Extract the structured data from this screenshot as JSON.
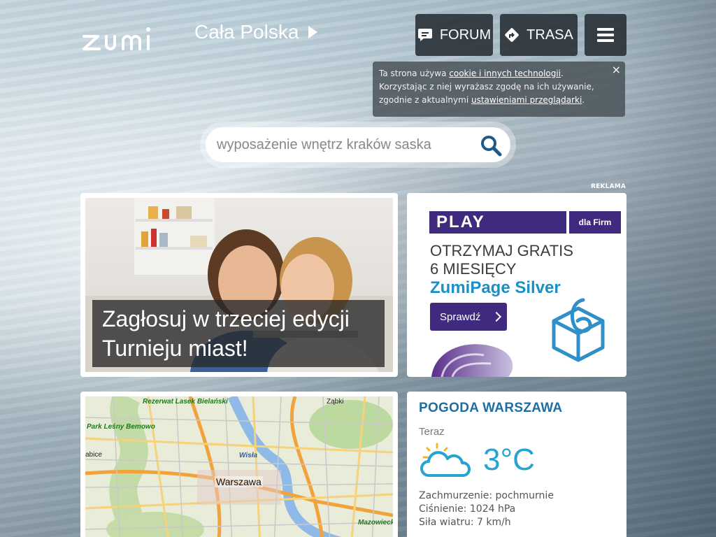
{
  "header": {
    "region": "Cała Polska",
    "nav": {
      "forum": "FORUM",
      "trasa": "TRASA"
    }
  },
  "cookie": {
    "text1": "Ta strona używa ",
    "link1": "cookie i innych technologii",
    "text2": ". Korzystając z niej wyrażasz zgodę na ich używanie, zgodnie z aktualnymi ",
    "link2": "ustawieniami przeglądarki",
    "text3": ".",
    "close": "×"
  },
  "search": {
    "placeholder": "wyposażenie wnętrz kraków saska"
  },
  "ad_label": "REKLAMA",
  "promo": {
    "caption": "Zagłosuj w trzeciej edycji Turnieju miast!"
  },
  "ad": {
    "brand": "PLAY",
    "brand_sub": "dla Firm",
    "line1": "OTRZYMAJ GRATIS",
    "line2": "6 MIESIĘCY",
    "product": "ZumiPage Silver",
    "cta": "Sprawdź"
  },
  "map": {
    "city": "Warszawa",
    "labels": [
      "Rezerwat Lasek Bielański",
      "Park Leśny Bemowo",
      "Wisła",
      "Mazowiecki"
    ],
    "places": [
      "Ząbki",
      "abice"
    ]
  },
  "weather": {
    "title": "POGODA WARSZAWA",
    "now": "Teraz",
    "temp": "3°C",
    "clouds": "Zachmurzenie: pochmurnie",
    "pressure": "Ciśnienie: 1024 hPa",
    "wind": "Siła wiatru: 7 km/h"
  },
  "colors": {
    "accent": "#27a3d3",
    "play": "#3f2a7f",
    "weather_title": "#1e6fa0"
  }
}
